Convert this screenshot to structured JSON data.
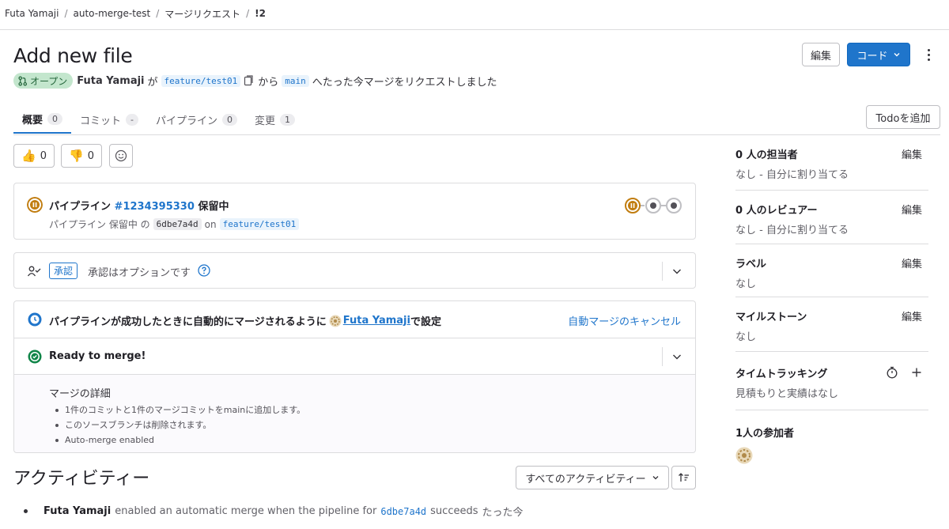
{
  "breadcrumb": [
    "Futa Yamaji",
    "auto-merge-test",
    "マージリクエスト",
    "!2"
  ],
  "header": {
    "title": "Add new file",
    "edit_label": "編集",
    "code_label": "コード"
  },
  "meta": {
    "status": "オープン",
    "author": "Futa Yamaji",
    "ga": "が",
    "source_branch": "feature/test01",
    "kara": "から",
    "target_branch": "main",
    "suffix": "へたった今マージをリクエストしました"
  },
  "tabs": [
    {
      "label": "概要",
      "count": "0"
    },
    {
      "label": "コミット",
      "count": "-"
    },
    {
      "label": "パイプライン",
      "count": "0"
    },
    {
      "label": "変更",
      "count": "1"
    }
  ],
  "todo_label": "Todoを追加",
  "reactions": {
    "thumbs_up": "0",
    "thumbs_down": "0"
  },
  "pipeline": {
    "prefix": "パイプライン",
    "id": "#1234395330",
    "status": "保留中",
    "sub_prefix": "パイプライン 保留中 の",
    "sha": "6dbe7a4d",
    "on": "on",
    "branch": "feature/test01",
    "status_color": "#c17d10"
  },
  "approval": {
    "badge": "承認",
    "text": "承認はオプションです"
  },
  "auto_merge": {
    "text_before": "パイプラインが成功したときに自動的にマージされるように",
    "user": "Futa Yamaji",
    "text_after": "で設定",
    "cancel_label": "自動マージのキャンセル"
  },
  "ready": {
    "text": "Ready to merge!",
    "details_title": "マージの詳細",
    "details": [
      "1件のコミットと1件のマージコミットをmainに追加します。",
      "このソースブランチは削除されます。",
      "Auto-merge enabled"
    ]
  },
  "activity": {
    "heading": "アクティビティー",
    "filter": "すべてのアクティビティー",
    "item": {
      "author": "Futa Yamaji",
      "text": "enabled an automatic merge when the pipeline for",
      "sha": "6dbe7a4d",
      "suffix": "succeeds",
      "time": "たった今"
    }
  },
  "sidebar": {
    "assignees": {
      "title": "0 人の担当者",
      "edit": "編集",
      "value": "なし - 自分に割り当てる"
    },
    "reviewers": {
      "title": "0 人のレビュアー",
      "edit": "編集",
      "value": "なし - 自分に割り当てる"
    },
    "labels": {
      "title": "ラベル",
      "edit": "編集",
      "value": "なし"
    },
    "milestone": {
      "title": "マイルストーン",
      "edit": "編集",
      "value": "なし"
    },
    "time_tracking": {
      "title": "タイムトラッキング",
      "value": "見積もりと実績はなし"
    },
    "participants": {
      "title": "1人の参加者"
    }
  },
  "colors": {
    "accent": "#1f75cb",
    "success": "#108548",
    "pending": "#c17d10"
  }
}
